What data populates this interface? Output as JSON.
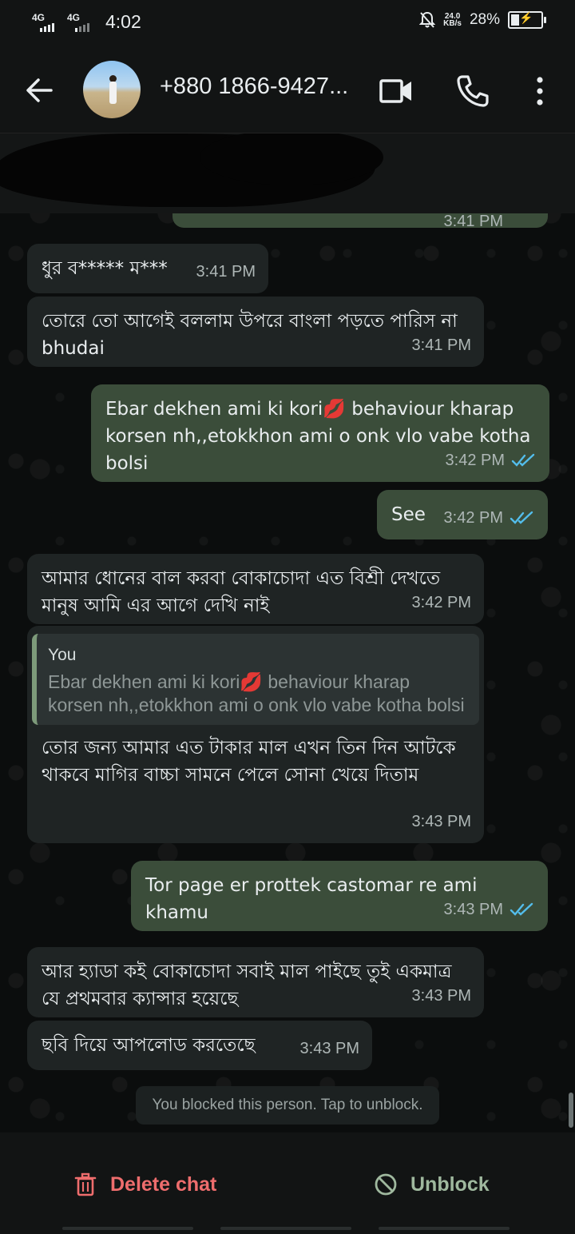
{
  "status_bar": {
    "network_1": "4G",
    "network_2": "4G",
    "time": "4:02",
    "speed_value": "24.0",
    "speed_unit": "KB/s",
    "battery_percent": "28%",
    "battery_level": 0.28
  },
  "header": {
    "contact_name": "+880 1866-9427..."
  },
  "partial_message_time": "3:41 PM",
  "messages": [
    {
      "direction": "in",
      "text": "ধুর ব***** ম***",
      "time": "3:41 PM"
    },
    {
      "direction": "in",
      "text": "তোরে তো আগেই বললাম উপরে বাংলা পড়তে পারিস না bhudai",
      "time": "3:41 PM"
    },
    {
      "direction": "out",
      "text": "Ebar dekhen ami ki kori💋 behaviour kharap korsen nh,,etokkhon ami o onk vlo vabe kotha bolsi",
      "time": "3:42 PM",
      "read": true
    },
    {
      "direction": "out",
      "text": "See",
      "time": "3:42 PM",
      "read": true
    },
    {
      "direction": "in",
      "text": "আমার ধোনের বাল করবা বোকাচোদা এত বিশ্রী দেখতে মানুষ আমি এর আগে দেখি নাই",
      "time": "3:42 PM"
    },
    {
      "direction": "in",
      "quote_author": "You",
      "quote_text": "Ebar dekhen ami ki kori💋 behaviour kharap korsen nh,,etokkhon ami o onk vlo vabe kotha bolsi",
      "text": "তোর জন্য আমার এত টাকার মাল এখন তিন দিন আটকে থাকবে মাগির বাচ্চা সামনে পেলে সোনা খেয়ে দিতাম",
      "time": "3:43 PM"
    },
    {
      "direction": "out",
      "text": "Tor page er prottek castomar re ami khamu",
      "time": "3:43 PM",
      "read": true
    },
    {
      "direction": "in",
      "text": "আর হ্যাডা কই বোকাচোদা সবাই মাল পাইছে তুই একমাত্র যে প্রথমবার ক্যান্সার হয়েছে",
      "time": "3:43 PM"
    },
    {
      "direction": "in",
      "text": "ছবি দিয়ে আপলোড করতেছে",
      "time": "3:43 PM"
    }
  ],
  "blocked_notice": "You blocked this person. Tap to unblock.",
  "actions": {
    "delete_label": "Delete chat",
    "unblock_label": "Unblock"
  },
  "colors": {
    "incoming_bubble": "#1f2424",
    "outgoing_bubble": "#3b4d3a",
    "read_ticks": "#53bdeb",
    "delete_red": "#ee6d6d",
    "unblock_green": "#9fb89e"
  }
}
